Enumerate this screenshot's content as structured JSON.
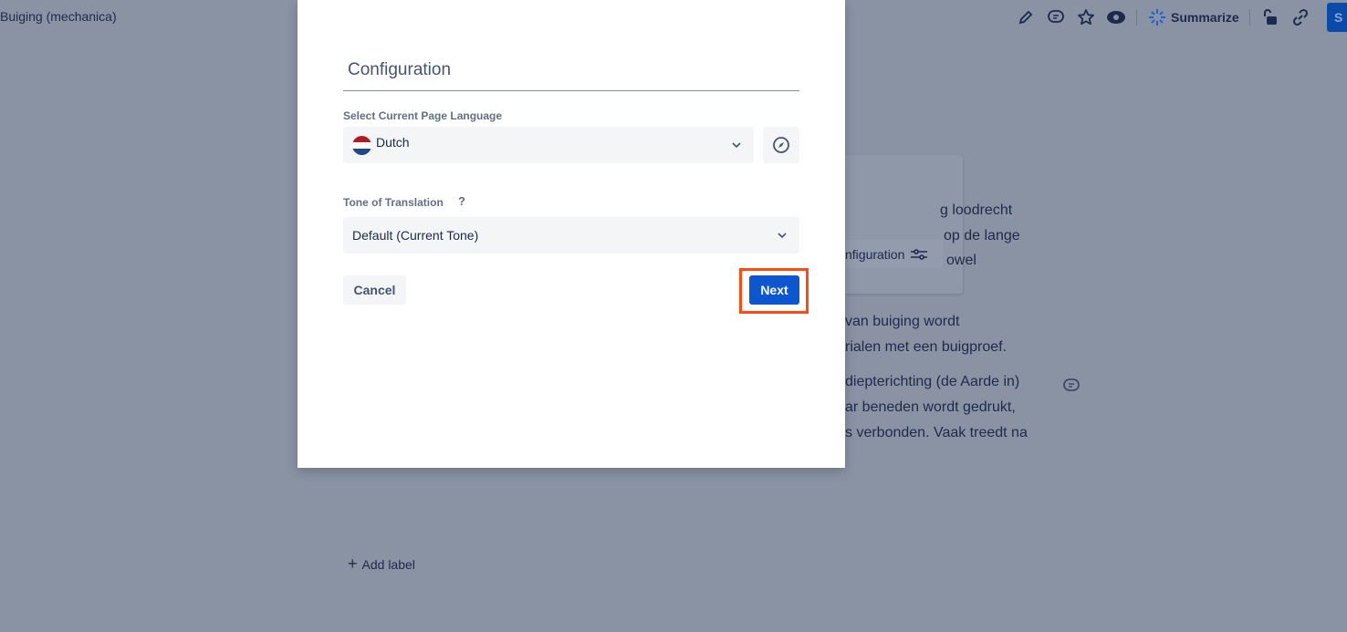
{
  "page": {
    "title": "Buiging (mechanica)",
    "add_label": "Add label"
  },
  "toolbar": {
    "summarize": "Summarize",
    "share_partial": "S",
    "icons": [
      "pencil-icon",
      "comment-icon",
      "star-icon",
      "eye-icon",
      "sparkle-icon",
      "unlock-icon",
      "link-icon"
    ]
  },
  "background": {
    "lines": [
      "g loodrecht",
      "op de lange",
      "owel",
      "van buiging wordt",
      "rialen met een buigproef.",
      "diepterichting (de Aarde in)",
      "ar beneden wordt gedrukt,",
      "s verbonden. Vaak treedt na"
    ],
    "config_button": "nfiguration"
  },
  "modal": {
    "title": "Configuration",
    "language_label": "Select Current Page Language",
    "language_value": "Dutch",
    "tone_label": "Tone of Translation",
    "tone_help": "?",
    "tone_value": "Default (Current Tone)",
    "cancel": "Cancel",
    "next": "Next"
  },
  "colors": {
    "primary": "#0c56d0",
    "highlight": "#ff4a12",
    "overlay": "#8993a4"
  }
}
